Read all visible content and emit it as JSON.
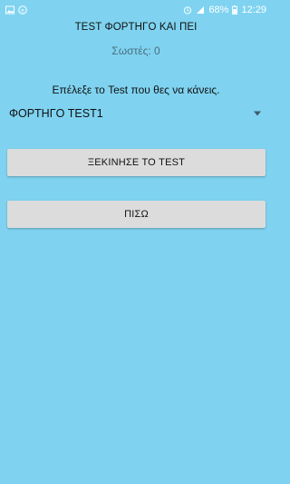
{
  "status_bar": {
    "battery_percent": "68%",
    "time": "12:29",
    "left_icons": [
      "image-icon",
      "app-notification-icon"
    ],
    "right_icons": [
      "alarm-icon",
      "signal-icon",
      "battery-icon"
    ]
  },
  "header": {
    "title": "TEST ΦΟΡΤΗΓΟ ΚΑΙ ΠΕΙ",
    "score_text": "Σωστές: 0"
  },
  "selection": {
    "prompt": "Επέλεξε το Test που θες να κάνεις.",
    "selected_value": "ΦΟΡΤΗΓΟ TEST1"
  },
  "buttons": {
    "start_label": "ΞΕΚΙΝΗΣΕ ΤΟ TEST",
    "back_label": "ΠΙΣΩ"
  },
  "colors": {
    "background": "#7fd3f0",
    "button": "#dcdcdc",
    "score_text": "#4a6f7d"
  }
}
